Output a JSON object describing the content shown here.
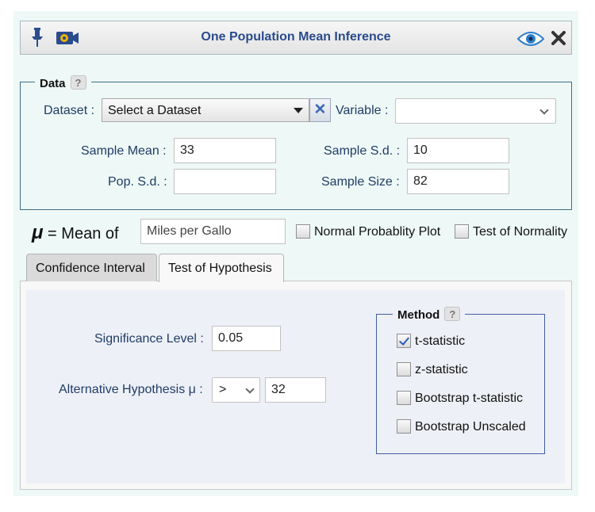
{
  "window": {
    "title": "One Population Mean Inference"
  },
  "data_section": {
    "legend": "Data",
    "help": "?",
    "dataset_label": "Dataset :",
    "dataset_value": "Select a Dataset",
    "clear_symbol": "✕",
    "variable_label": "Variable :",
    "variable_value": "",
    "sample_mean_label": "Sample Mean :",
    "sample_mean_value": "33",
    "sample_sd_label": "Sample S.d. :",
    "sample_sd_value": "10",
    "pop_sd_label": "Pop. S.d. :",
    "pop_sd_value": "",
    "sample_size_label": "Sample Size :",
    "sample_size_value": "82"
  },
  "mean_of": {
    "mu": "μ",
    "label": "= Mean of",
    "value": "Miles per Gallo"
  },
  "checkboxes": {
    "normal_plot": "Normal Probablity Plot",
    "normality_test": "Test of Normality"
  },
  "tabs": {
    "confidence": "Confidence Interval",
    "hypothesis": "Test of Hypothesis"
  },
  "hypothesis": {
    "sig_label": "Significance Level :",
    "sig_value": "0.05",
    "alt_label": "Alternative Hypothesis μ :",
    "alt_operator": ">",
    "alt_value": "32"
  },
  "method": {
    "legend": "Method",
    "help": "?",
    "options": [
      {
        "label": "t-statistic",
        "checked": true
      },
      {
        "label": "z-statistic",
        "checked": false
      },
      {
        "label": "Bootstrap t-statistic",
        "checked": false
      },
      {
        "label": "Bootstrap Unscaled",
        "checked": false
      }
    ]
  },
  "colors": {
    "title": "#2a4b8d",
    "panel_bg": "#eef8f6",
    "label": "#1f3d66",
    "accent": "#2f5db8"
  },
  "icons": [
    "pin-icon",
    "video-camera-icon",
    "eye-icon",
    "close-icon",
    "chevron-down-icon",
    "help-icon"
  ]
}
